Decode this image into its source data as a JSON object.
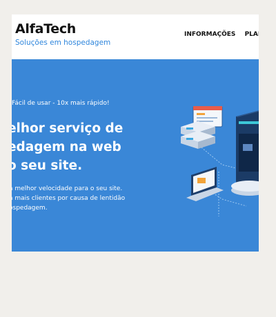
{
  "header": {
    "brand_name": "AlfaTech",
    "brand_tagline": "Soluções em hospedagem",
    "nav_items": [
      "INFORMAÇÕES",
      "PLANO"
    ]
  },
  "hero": {
    "kicker": "Fácil de usar - 10x mais rápido!",
    "title_lines": [
      "elhor serviço de",
      "edagem na web",
      "o seu site."
    ],
    "description_lines": [
      "a melhor velocidade para o seu site.",
      "a mais clientes por causa de lentidão",
      "ospedagem."
    ]
  },
  "colors": {
    "hero_background": "#3a87d7",
    "tagline": "#2f86dc",
    "page_background": "#f1efeb"
  }
}
